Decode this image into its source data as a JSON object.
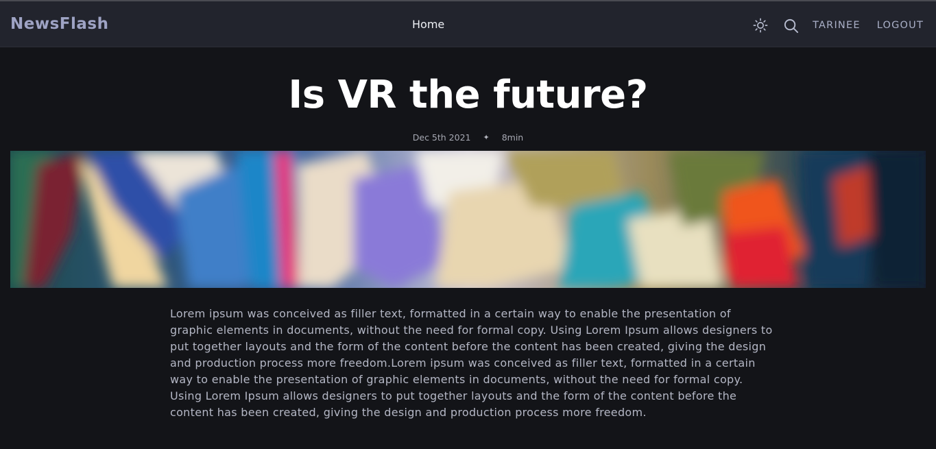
{
  "navbar": {
    "brand": "NewsFlash",
    "home_label": "Home",
    "theme_icon": "sun-icon",
    "search_icon": "search-icon",
    "user_label": "TARINEE",
    "logout_label": "LOGOUT"
  },
  "article": {
    "title": "Is VR the future?",
    "date": "Dec 5th 2021",
    "separator": "✦",
    "read_time": "8min",
    "body": "Lorem ipsum was conceived as filler text, formatted in a certain way to enable the presentation of graphic elements in documents, without the need for formal copy. Using Lorem Ipsum allows designers to put together layouts and the form of the content before the content has been created, giving the design and production process more freedom.Lorem ipsum was conceived as filler text, formatted in a certain way to enable the presentation of graphic elements in documents, without the need for formal copy. Using Lorem Ipsum allows designers to put together layouts and the form of the content before the content has been created, giving the design and production process more freedom."
  },
  "colors": {
    "background": "#131418",
    "navbar": "#22242d",
    "brand": "#9ea3c4",
    "title": "#ffffff",
    "body_text": "#b4b7c5"
  }
}
